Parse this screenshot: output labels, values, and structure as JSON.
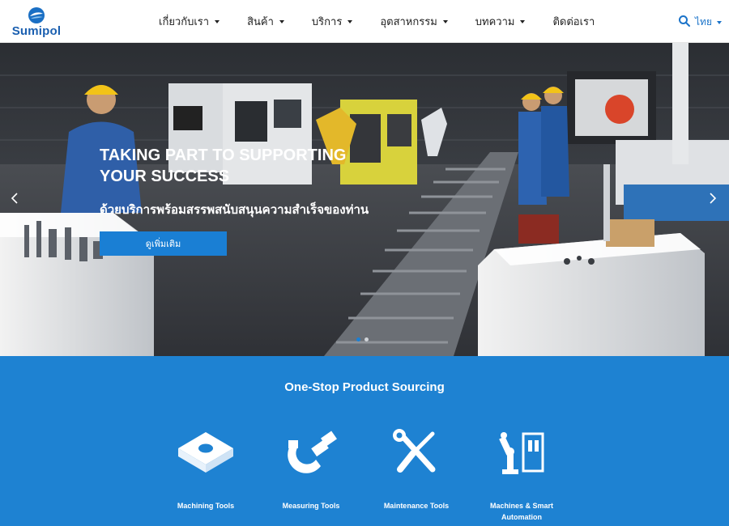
{
  "brand": {
    "name": "Sumipol"
  },
  "nav": {
    "items": [
      {
        "label": "เกี่ยวกับเรา",
        "has_dropdown": true
      },
      {
        "label": "สินค้า",
        "has_dropdown": true
      },
      {
        "label": "บริการ",
        "has_dropdown": true
      },
      {
        "label": "อุตสาหกรรม",
        "has_dropdown": true
      },
      {
        "label": "บทความ",
        "has_dropdown": true
      },
      {
        "label": "ติดต่อเรา",
        "has_dropdown": false
      }
    ],
    "search_icon": "search-icon",
    "language": "ไทย"
  },
  "hero": {
    "title_line1": "TAKING PART TO SUPPORTING",
    "title_line2": "YOUR SUCCESS",
    "subtitle": "ด้วยบริการพร้อมสรรพสนับสนุนความสำเร็จของท่าน",
    "cta_label": "ดูเพิ่มเติม",
    "slide_count": 2,
    "active_slide": 1
  },
  "products": {
    "title": "One-Stop Product Sourcing",
    "items": [
      {
        "label": "Machining Tools",
        "icon": "insert-tool-icon"
      },
      {
        "label": "Measuring Tools",
        "icon": "micrometer-icon"
      },
      {
        "label": "Maintenance Tools",
        "icon": "wrench-screwdriver-icon"
      },
      {
        "label": "Machines & Smart Automation",
        "icon": "robot-arm-icon"
      }
    ]
  },
  "colors": {
    "brand_blue": "#1a5fb0",
    "accent_blue": "#1a7fd4",
    "section_blue": "#1e82d2"
  }
}
